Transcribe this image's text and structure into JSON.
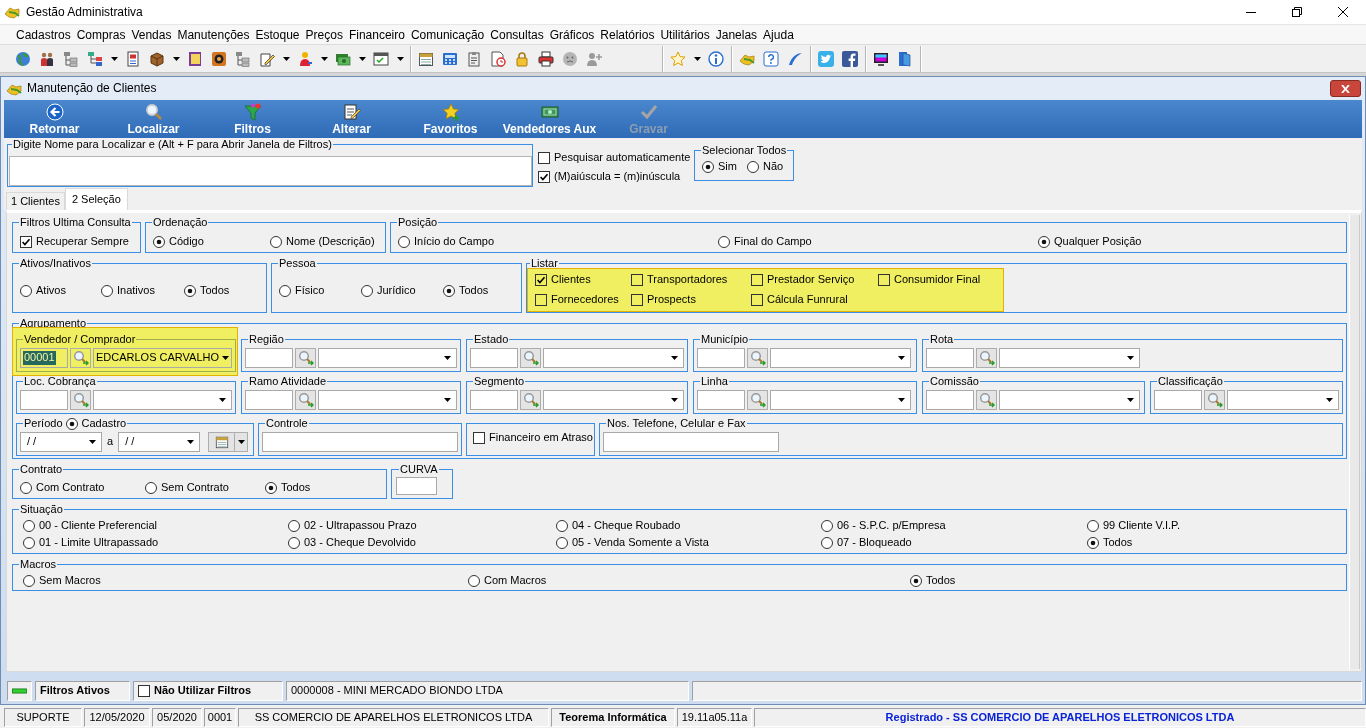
{
  "window": {
    "title": "Gestão Administrativa"
  },
  "menu": [
    "Cadastros",
    "Compras",
    "Vendas",
    "Manutenções",
    "Estoque",
    "Preços",
    "Financeiro",
    "Comunicação",
    "Consultas",
    "Gráficos",
    "Relatórios",
    "Utilitários",
    "Janelas",
    "Ajuda"
  ],
  "child_window": {
    "title": "Manutenção de Clientes",
    "toolbar": [
      {
        "label": "Retornar",
        "disabled": false
      },
      {
        "label": "Localizar",
        "disabled": false
      },
      {
        "label": "Filtros",
        "disabled": false
      },
      {
        "label": "Alterar",
        "disabled": false
      },
      {
        "label": "Favoritos",
        "disabled": false
      },
      {
        "label": "Vendedores Aux",
        "disabled": false
      },
      {
        "label": "Gravar",
        "disabled": true
      }
    ],
    "search": {
      "legend": "Digite Nome para Localizar e (Alt + F para Abrir Janela de Filtros)"
    },
    "search_options": [
      {
        "label": "Pesquisar automaticamente",
        "checked": false
      },
      {
        "label": "(M)aiúscula = (m)inúscula",
        "checked": true
      }
    ],
    "select_all": {
      "legend": "Selecionar Todos",
      "options": [
        {
          "label": "Sim",
          "selected": true
        },
        {
          "label": "Não",
          "selected": false
        }
      ]
    },
    "tabs": [
      {
        "label": "1 Clientes",
        "selected": false
      },
      {
        "label": "2 Seleção",
        "selected": true
      }
    ],
    "filters": {
      "last_query": {
        "legend": "Filtros Ultima Consulta",
        "options": [
          {
            "label": "Recuperar Sempre",
            "checked": true
          }
        ]
      },
      "ordering": {
        "legend": "Ordenação",
        "options": [
          {
            "label": "Código",
            "selected": true
          },
          {
            "label": "Nome (Descrição)",
            "selected": false
          }
        ]
      },
      "position": {
        "legend": "Posição",
        "options": [
          {
            "label": "Início do Campo",
            "selected": false
          },
          {
            "label": "Final do Campo",
            "selected": false
          },
          {
            "label": "Qualquer Posição",
            "selected": true
          }
        ]
      },
      "active": {
        "legend": "Ativos/Inativos",
        "options": [
          {
            "label": "Ativos",
            "selected": false
          },
          {
            "label": "Inativos",
            "selected": false
          },
          {
            "label": "Todos",
            "selected": true
          }
        ]
      },
      "person": {
        "legend": "Pessoa",
        "options": [
          {
            "label": "Físico",
            "selected": false
          },
          {
            "label": "Jurídico",
            "selected": false
          },
          {
            "label": "Todos",
            "selected": true
          }
        ]
      },
      "list": {
        "legend": "Listar",
        "highlighted": true,
        "options": [
          {
            "label": "Clientes",
            "checked": true
          },
          {
            "label": "Transportadores",
            "checked": false
          },
          {
            "label": "Prestador Serviço",
            "checked": false
          },
          {
            "label": "Consumidor Final",
            "checked": false
          },
          {
            "label": "Fornecedores",
            "checked": false
          },
          {
            "label": "Prospects",
            "checked": false
          },
          {
            "label": "Cálcula Funrural",
            "checked": false
          }
        ]
      },
      "grouping": {
        "legend": "Agrupamento",
        "lookups": [
          {
            "label": "Vendedor / Comprador",
            "code": "00001",
            "value": "EDCARLOS CARVALHO",
            "highlighted": true,
            "text_selected": true
          },
          {
            "label": "Região",
            "highlighted": false
          },
          {
            "label": "Estado",
            "highlighted": false
          },
          {
            "label": "Município",
            "highlighted": false
          },
          {
            "label": "Rota",
            "highlighted": false
          },
          {
            "label": "Loc. Cobrança",
            "highlighted": false
          },
          {
            "label": "Ramo Atividade",
            "highlighted": false
          },
          {
            "label": "Segmento",
            "highlighted": false
          },
          {
            "label": "Linha",
            "highlighted": false
          },
          {
            "label": "Comissão",
            "highlighted": false
          },
          {
            "label": "Classificação",
            "highlighted": false
          }
        ]
      },
      "period": {
        "legend": "Período",
        "option": {
          "label": "Cadastro",
          "selected": true
        },
        "from": "/ /",
        "separator": "a",
        "to": "/ /"
      },
      "control": {
        "legend": "Controle"
      },
      "overdue": {
        "label": "Financeiro em Atraso",
        "checked": false
      },
      "phones": {
        "legend": "Nos. Telefone, Celular e Fax"
      },
      "contract": {
        "legend": "Contrato",
        "options": [
          {
            "label": "Com Contrato",
            "selected": false
          },
          {
            "label": "Sem Contrato",
            "selected": false
          },
          {
            "label": "Todos",
            "selected": true
          }
        ]
      },
      "curve": {
        "legend": "CURVA"
      },
      "situation": {
        "legend": "Situação",
        "options": [
          {
            "label": "00 - Cliente Preferencial",
            "selected": false
          },
          {
            "label": "02 - Ultrapassou Prazo",
            "selected": false
          },
          {
            "label": "04 - Cheque Roubado",
            "selected": false
          },
          {
            "label": "06 - S.P.C. p/Empresa",
            "selected": false
          },
          {
            "label": "99 Cliente V.I.P.",
            "selected": false
          },
          {
            "label": "01 - Limite Ultrapassado",
            "selected": false
          },
          {
            "label": "03 - Cheque Devolvido",
            "selected": false
          },
          {
            "label": "05 - Venda Somente a Vista",
            "selected": false
          },
          {
            "label": "07 - Bloqueado",
            "selected": false
          },
          {
            "label": "Todos",
            "selected": true
          }
        ]
      },
      "macros": {
        "legend": "Macros",
        "options": [
          {
            "label": "Sem Macros",
            "selected": false
          },
          {
            "label": "Com Macros",
            "selected": false
          },
          {
            "label": "Todos",
            "selected": true
          }
        ]
      }
    },
    "status_bar": {
      "label": "Filtros Ativos",
      "no_filters": {
        "label": "Não Utilizar Filtros",
        "checked": false
      },
      "record": "0000008 - MINI MERCADO BIONDO LTDA"
    }
  },
  "status_bar": [
    {
      "text": "SUPORTE",
      "kind": "plain"
    },
    {
      "text": "12/05/2020",
      "kind": "plain"
    },
    {
      "text": "05/2020",
      "kind": "plain"
    },
    {
      "text": "0001",
      "kind": "plain"
    },
    {
      "text": "SS COMERCIO DE APARELHOS ELETRONICOS LTDA",
      "kind": "plain"
    },
    {
      "text": "Teorema Informática",
      "kind": "bold"
    },
    {
      "text": "19.11a05.11a",
      "kind": "plain"
    },
    {
      "text": "Registrado - SS COMERCIO DE APARELHOS ELETRONICOS LTDA",
      "kind": "registered"
    }
  ]
}
